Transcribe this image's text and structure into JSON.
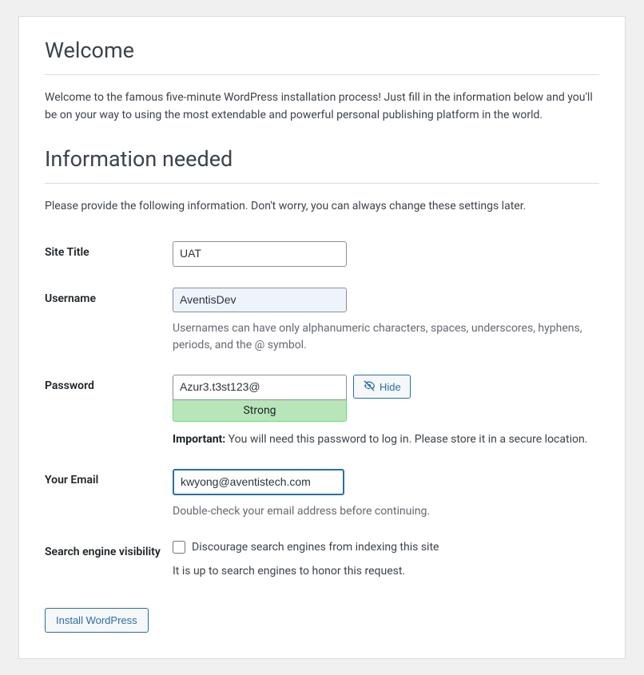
{
  "headings": {
    "welcome": "Welcome",
    "info_needed": "Information needed"
  },
  "intro": {
    "welcome_text": "Welcome to the famous five-minute WordPress installation process! Just fill in the information below and you'll be on your way to using the most extendable and powerful personal publishing platform in the world.",
    "info_text": "Please provide the following information. Don't worry, you can always change these settings later."
  },
  "labels": {
    "site_title": "Site Title",
    "username": "Username",
    "password": "Password",
    "email": "Your Email",
    "search_visibility": "Search engine visibility"
  },
  "fields": {
    "site_title_value": "UAT",
    "username_value": "AventisDev",
    "username_hint": "Usernames can have only alphanumeric characters, spaces, underscores, hyphens, periods, and the @ symbol.",
    "password_value": "Azur3.t3st123@",
    "password_strength": "Strong",
    "hide_button": "Hide",
    "important_prefix": "Important:",
    "important_text": " You will need this password to log in. Please store it in a secure location.",
    "email_value": "kwyong@aventistech.com",
    "email_hint": "Double-check your email address before continuing.",
    "discourage_label": "Discourage search engines from indexing this site",
    "discourage_note": "It is up to search engines to honor this request."
  },
  "buttons": {
    "install": "Install WordPress"
  }
}
